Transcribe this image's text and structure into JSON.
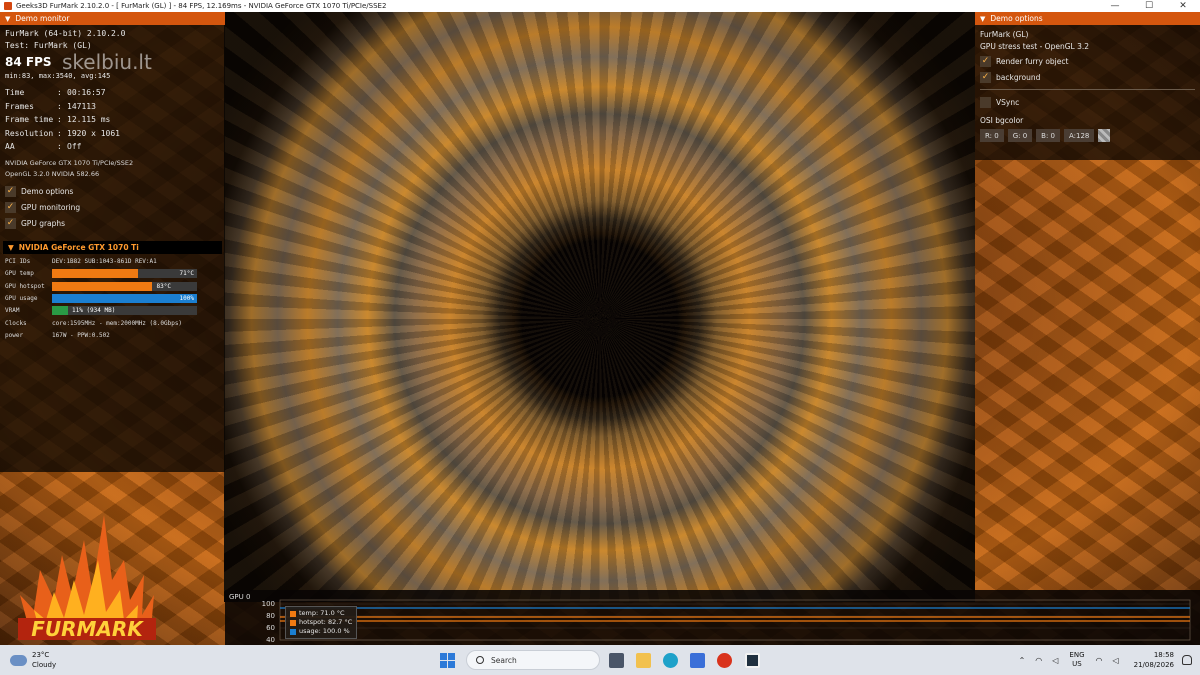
{
  "window": {
    "title": "Geeks3D FurMark 2.10.2.0 - [ FurMark (GL) ] - 84 FPS, 12.169ms - NVIDIA GeForce GTX 1070 Ti/PCIe/SSE2",
    "minimize": "—",
    "maximize": "☐",
    "close": "✕"
  },
  "watermark": "skelbiu.lt",
  "demo_monitor": {
    "header": "Demo monitor",
    "app_line": "FurMark (64-bit) 2.10.2.0",
    "test_line": "Test: FurMark (GL)",
    "fps": "84 FPS",
    "minmax": "min:83, max:3540, avg:145",
    "stats": [
      {
        "label": "Time",
        "value": "00:16:57"
      },
      {
        "label": "Frames",
        "value": "147113"
      },
      {
        "label": "Frame time",
        "value": "12.115 ms"
      },
      {
        "label": "Resolution",
        "value": "1920 x 1061"
      },
      {
        "label": "AA",
        "value": "Off"
      }
    ],
    "renderer": "NVIDIA GeForce GTX 1070 Ti/PCIe/SSE2",
    "opengl": "OpenGL 3.2.0 NVIDIA 582.66",
    "options": [
      {
        "label": "Demo options",
        "checked": true
      },
      {
        "label": "GPU monitoring",
        "checked": true
      },
      {
        "label": "GPU graphs",
        "checked": true
      }
    ]
  },
  "gpu": {
    "header": "NVIDIA GeForce GTX 1070 Ti",
    "pci_label": "PCI IDs",
    "pci_value": "DEV:1B82 SUB:1043-861D REV:A1",
    "temp_label": "GPU temp",
    "temp_value": "71°C",
    "temp_fraction": 0.59,
    "hotspot_label": "GPU hotspot",
    "hotspot_value": "83°C",
    "hotspot_fraction": 0.69,
    "usage_label": "GPU usage",
    "usage_value": "100%",
    "usage_fraction": 1.0,
    "vram_label": "VRAM",
    "vram_value": "11% (934 MB)",
    "vram_fraction": 0.11,
    "clocks_label": "Clocks",
    "clocks_value": "core:1595MHz - mem:2000MHz (8.0Gbps)",
    "power_label": "power",
    "power_value": "167W - PPW:0.502",
    "colors": {
      "temp": "#f07a12",
      "hotspot": "#f07a12",
      "usage": "#1b7fd1",
      "vram": "#2a9a45"
    }
  },
  "demo_options": {
    "header": "Demo options",
    "app_line": "FurMark (GL)",
    "desc": "GPU stress test - OpenGL 3.2",
    "checks": [
      {
        "label": "Render furry object",
        "checked": true
      },
      {
        "label": "background",
        "checked": true
      }
    ],
    "vsync": {
      "label": "VSync",
      "checked": false
    },
    "osi_label": "OSI bgcolor",
    "color_fields": [
      "R: 0",
      "G: 0",
      "B: 0",
      "A:128"
    ]
  },
  "graph": {
    "title": "GPU 0",
    "y_ticks": [
      "100",
      "80",
      "60",
      "40"
    ],
    "legend": [
      {
        "label": "temp: 71.0 °C",
        "color": "#f07a12"
      },
      {
        "label": "hotspot: 82.7 °C",
        "color": "#f07a12"
      },
      {
        "label": "usage: 100.0 %",
        "color": "#1b7fd1"
      }
    ]
  },
  "taskbar": {
    "temperature": "23°C",
    "weather": "Cloudy",
    "search_placeholder": "Search",
    "lang_top": "ENG",
    "lang_bottom": "US",
    "time": "18:58",
    "date": "21/08/2026"
  }
}
